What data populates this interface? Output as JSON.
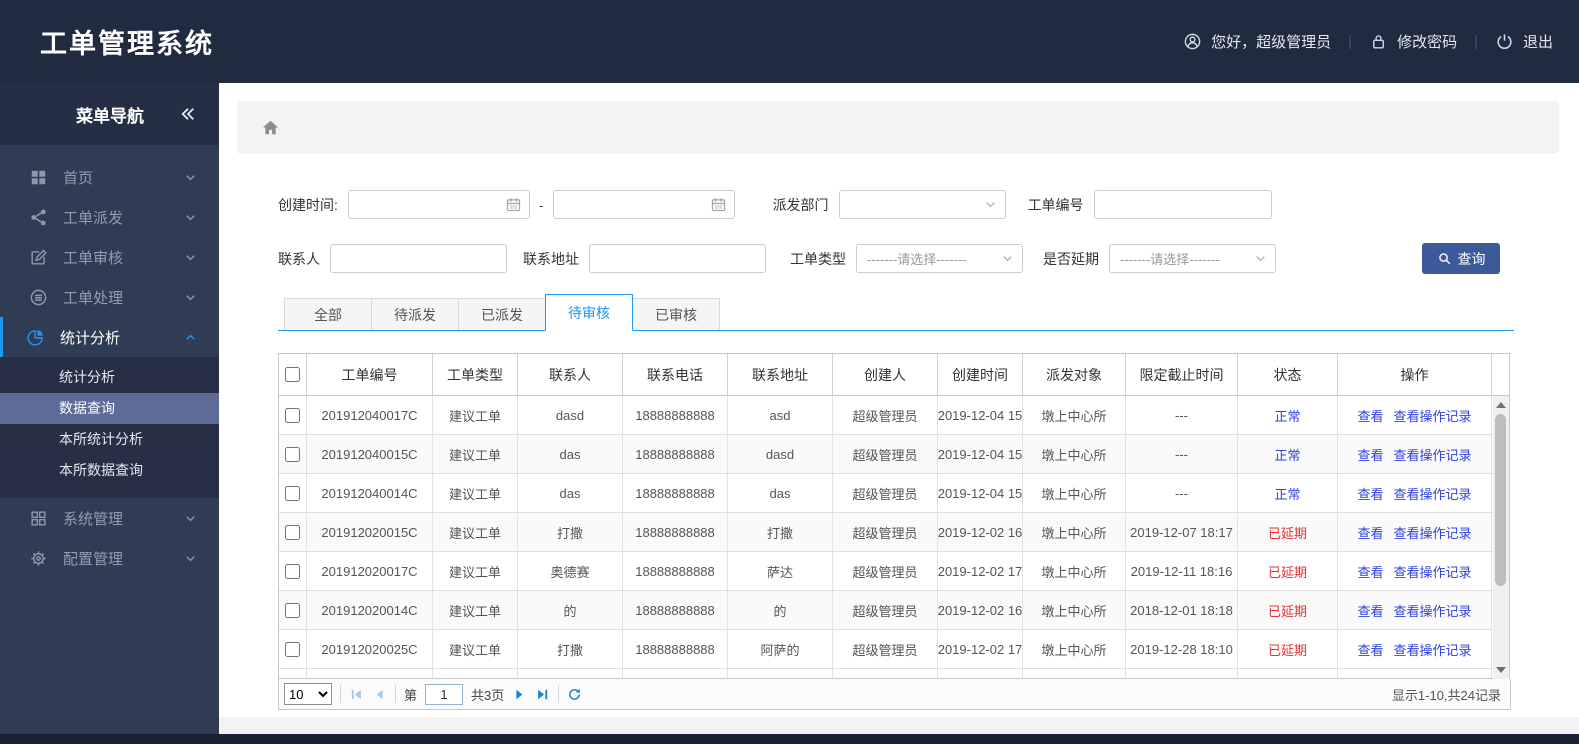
{
  "header": {
    "title": "工单管理系统",
    "greeting": "您好，超级管理员",
    "change_password": "修改密码",
    "logout": "退出"
  },
  "sidebar": {
    "title": "菜单导航",
    "items": [
      {
        "label": "首页",
        "icon": "grid",
        "expanded": false
      },
      {
        "label": "工单派发",
        "icon": "share",
        "expanded": false
      },
      {
        "label": "工单审核",
        "icon": "edit",
        "expanded": false
      },
      {
        "label": "工单处理",
        "icon": "discs",
        "expanded": false
      },
      {
        "label": "统计分析",
        "icon": "pie",
        "expanded": true,
        "children": [
          "统计分析",
          "数据查询",
          "本所统计分析",
          "本所数据查询"
        ],
        "active_child": "数据查询"
      },
      {
        "label": "系统管理",
        "icon": "grid2",
        "expanded": false
      },
      {
        "label": "配置管理",
        "icon": "gear",
        "expanded": false
      }
    ]
  },
  "filters": {
    "create_time_label": "创建时间:",
    "range_sep": "-",
    "dispatch_dept_label": "派发部门",
    "order_no_label": "工单编号",
    "contact_label": "联系人",
    "address_label": "联系地址",
    "order_type_label": "工单类型",
    "delay_label": "是否延期",
    "select_placeholder": "-------请选择-------",
    "search_button": "查询"
  },
  "tabs": {
    "items": [
      "全部",
      "待派发",
      "已派发",
      "待审核",
      "已审核"
    ],
    "active": "待审核"
  },
  "table": {
    "columns": [
      "工单编号",
      "工单类型",
      "联系人",
      "联系电话",
      "联系地址",
      "创建人",
      "创建时间",
      "派发对象",
      "限定截止时间",
      "状态",
      "操作"
    ],
    "action_labels": [
      "查看",
      "查看操作记录"
    ],
    "rows": [
      {
        "no": "201912040017C",
        "type": "建议工单",
        "contact": "dasd",
        "phone": "18888888888",
        "address": "asd",
        "creator": "超级管理员",
        "created": "2019-12-04 15",
        "target": "墩上中心所",
        "deadline": "---",
        "status": "正常",
        "status_kind": "normal"
      },
      {
        "no": "201912040015C",
        "type": "建议工单",
        "contact": "das",
        "phone": "18888888888",
        "address": "dasd",
        "creator": "超级管理员",
        "created": "2019-12-04 15",
        "target": "墩上中心所",
        "deadline": "---",
        "status": "正常",
        "status_kind": "normal"
      },
      {
        "no": "201912040014C",
        "type": "建议工单",
        "contact": "das",
        "phone": "18888888888",
        "address": "das",
        "creator": "超级管理员",
        "created": "2019-12-04 15",
        "target": "墩上中心所",
        "deadline": "---",
        "status": "正常",
        "status_kind": "normal"
      },
      {
        "no": "201912020015C",
        "type": "建议工单",
        "contact": "打撒",
        "phone": "18888888888",
        "address": "打撒",
        "creator": "超级管理员",
        "created": "2019-12-02 16",
        "target": "墩上中心所",
        "deadline": "2019-12-07 18:17",
        "status": "已延期",
        "status_kind": "overdue"
      },
      {
        "no": "201912020017C",
        "type": "建议工单",
        "contact": "奥德赛",
        "phone": "18888888888",
        "address": "萨达",
        "creator": "超级管理员",
        "created": "2019-12-02 17",
        "target": "墩上中心所",
        "deadline": "2019-12-11 18:16",
        "status": "已延期",
        "status_kind": "overdue"
      },
      {
        "no": "201912020014C",
        "type": "建议工单",
        "contact": "的",
        "phone": "18888888888",
        "address": "的",
        "creator": "超级管理员",
        "created": "2019-12-02 16",
        "target": "墩上中心所",
        "deadline": "2018-12-01 18:18",
        "status": "已延期",
        "status_kind": "overdue"
      },
      {
        "no": "201912020025C",
        "type": "建议工单",
        "contact": "打撒",
        "phone": "18888888888",
        "address": "阿萨的",
        "creator": "超级管理员",
        "created": "2019-12-02 17",
        "target": "墩上中心所",
        "deadline": "2019-12-28 18:10",
        "status": "已延期",
        "status_kind": "overdue"
      }
    ]
  },
  "pagination": {
    "page_size": "10",
    "page_prefix": "第",
    "current_page": "1",
    "total_pages": "共3页",
    "summary": "显示1-10,共24记录"
  },
  "colors": {
    "accent": "#2196f3",
    "link_blue": "#2f42dc",
    "overdue_red": "#e63030",
    "button_blue": "#3c5a9a",
    "header_navy": "#202b40",
    "sidebar_navy": "#303b54"
  }
}
